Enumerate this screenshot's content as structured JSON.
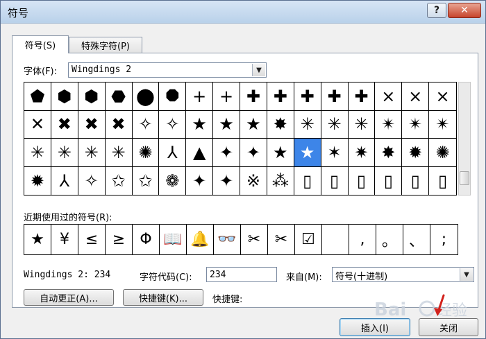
{
  "window": {
    "title": "符号",
    "help": "?",
    "close": "✕"
  },
  "tabs": [
    {
      "label": "符号(S)"
    },
    {
      "label": "特殊字符(P)"
    }
  ],
  "font": {
    "label": "字体(F):",
    "value": "Wingdings 2"
  },
  "symbols": [
    [
      "⬟",
      "⬢",
      "⬢",
      "⬣",
      "⬤",
      "⯃",
      "+",
      "+",
      "✚",
      "✚",
      "✚",
      "✚",
      "✚",
      "×",
      "×",
      "×"
    ],
    [
      "✕",
      "✖",
      "✖",
      "✖",
      "✧",
      "✧",
      "★",
      "★",
      "★",
      "✸",
      "✳",
      "✳",
      "✳",
      "✴",
      "✴",
      "✴"
    ],
    [
      "✳",
      "✳",
      "✳",
      "✳",
      "✺",
      "⅄",
      "▲",
      "✦",
      "✦",
      "★",
      "★",
      "✶",
      "✷",
      "✸",
      "✹",
      "✺"
    ],
    [
      "✹",
      "⅄",
      "✧",
      "✩",
      "✩",
      "❁",
      "✦",
      "✦",
      "※",
      "⁂",
      "▯",
      "▯",
      "▯",
      "▯",
      "▯",
      "▯"
    ]
  ],
  "selected": {
    "row": 2,
    "col": 10
  },
  "recent": {
    "label": "近期使用过的符号(R):",
    "items": [
      "★",
      "¥",
      "≤",
      "≥",
      "Φ",
      "📖",
      "🔔",
      "👓",
      "✂",
      "✂",
      "☑",
      "",
      ",",
      "。",
      "、",
      ";"
    ]
  },
  "info": {
    "charname": "Wingdings 2: 234",
    "code_label": "字符代码(C):",
    "code_value": "234",
    "from_label": "来自(M):",
    "from_value": "符号(十进制)"
  },
  "buttons": {
    "autocorrect": "自动更正(A)...",
    "shortcut": "快捷键(K)...",
    "shortcut_label": "快捷键:",
    "insert": "插入(I)",
    "close": "关闭"
  }
}
